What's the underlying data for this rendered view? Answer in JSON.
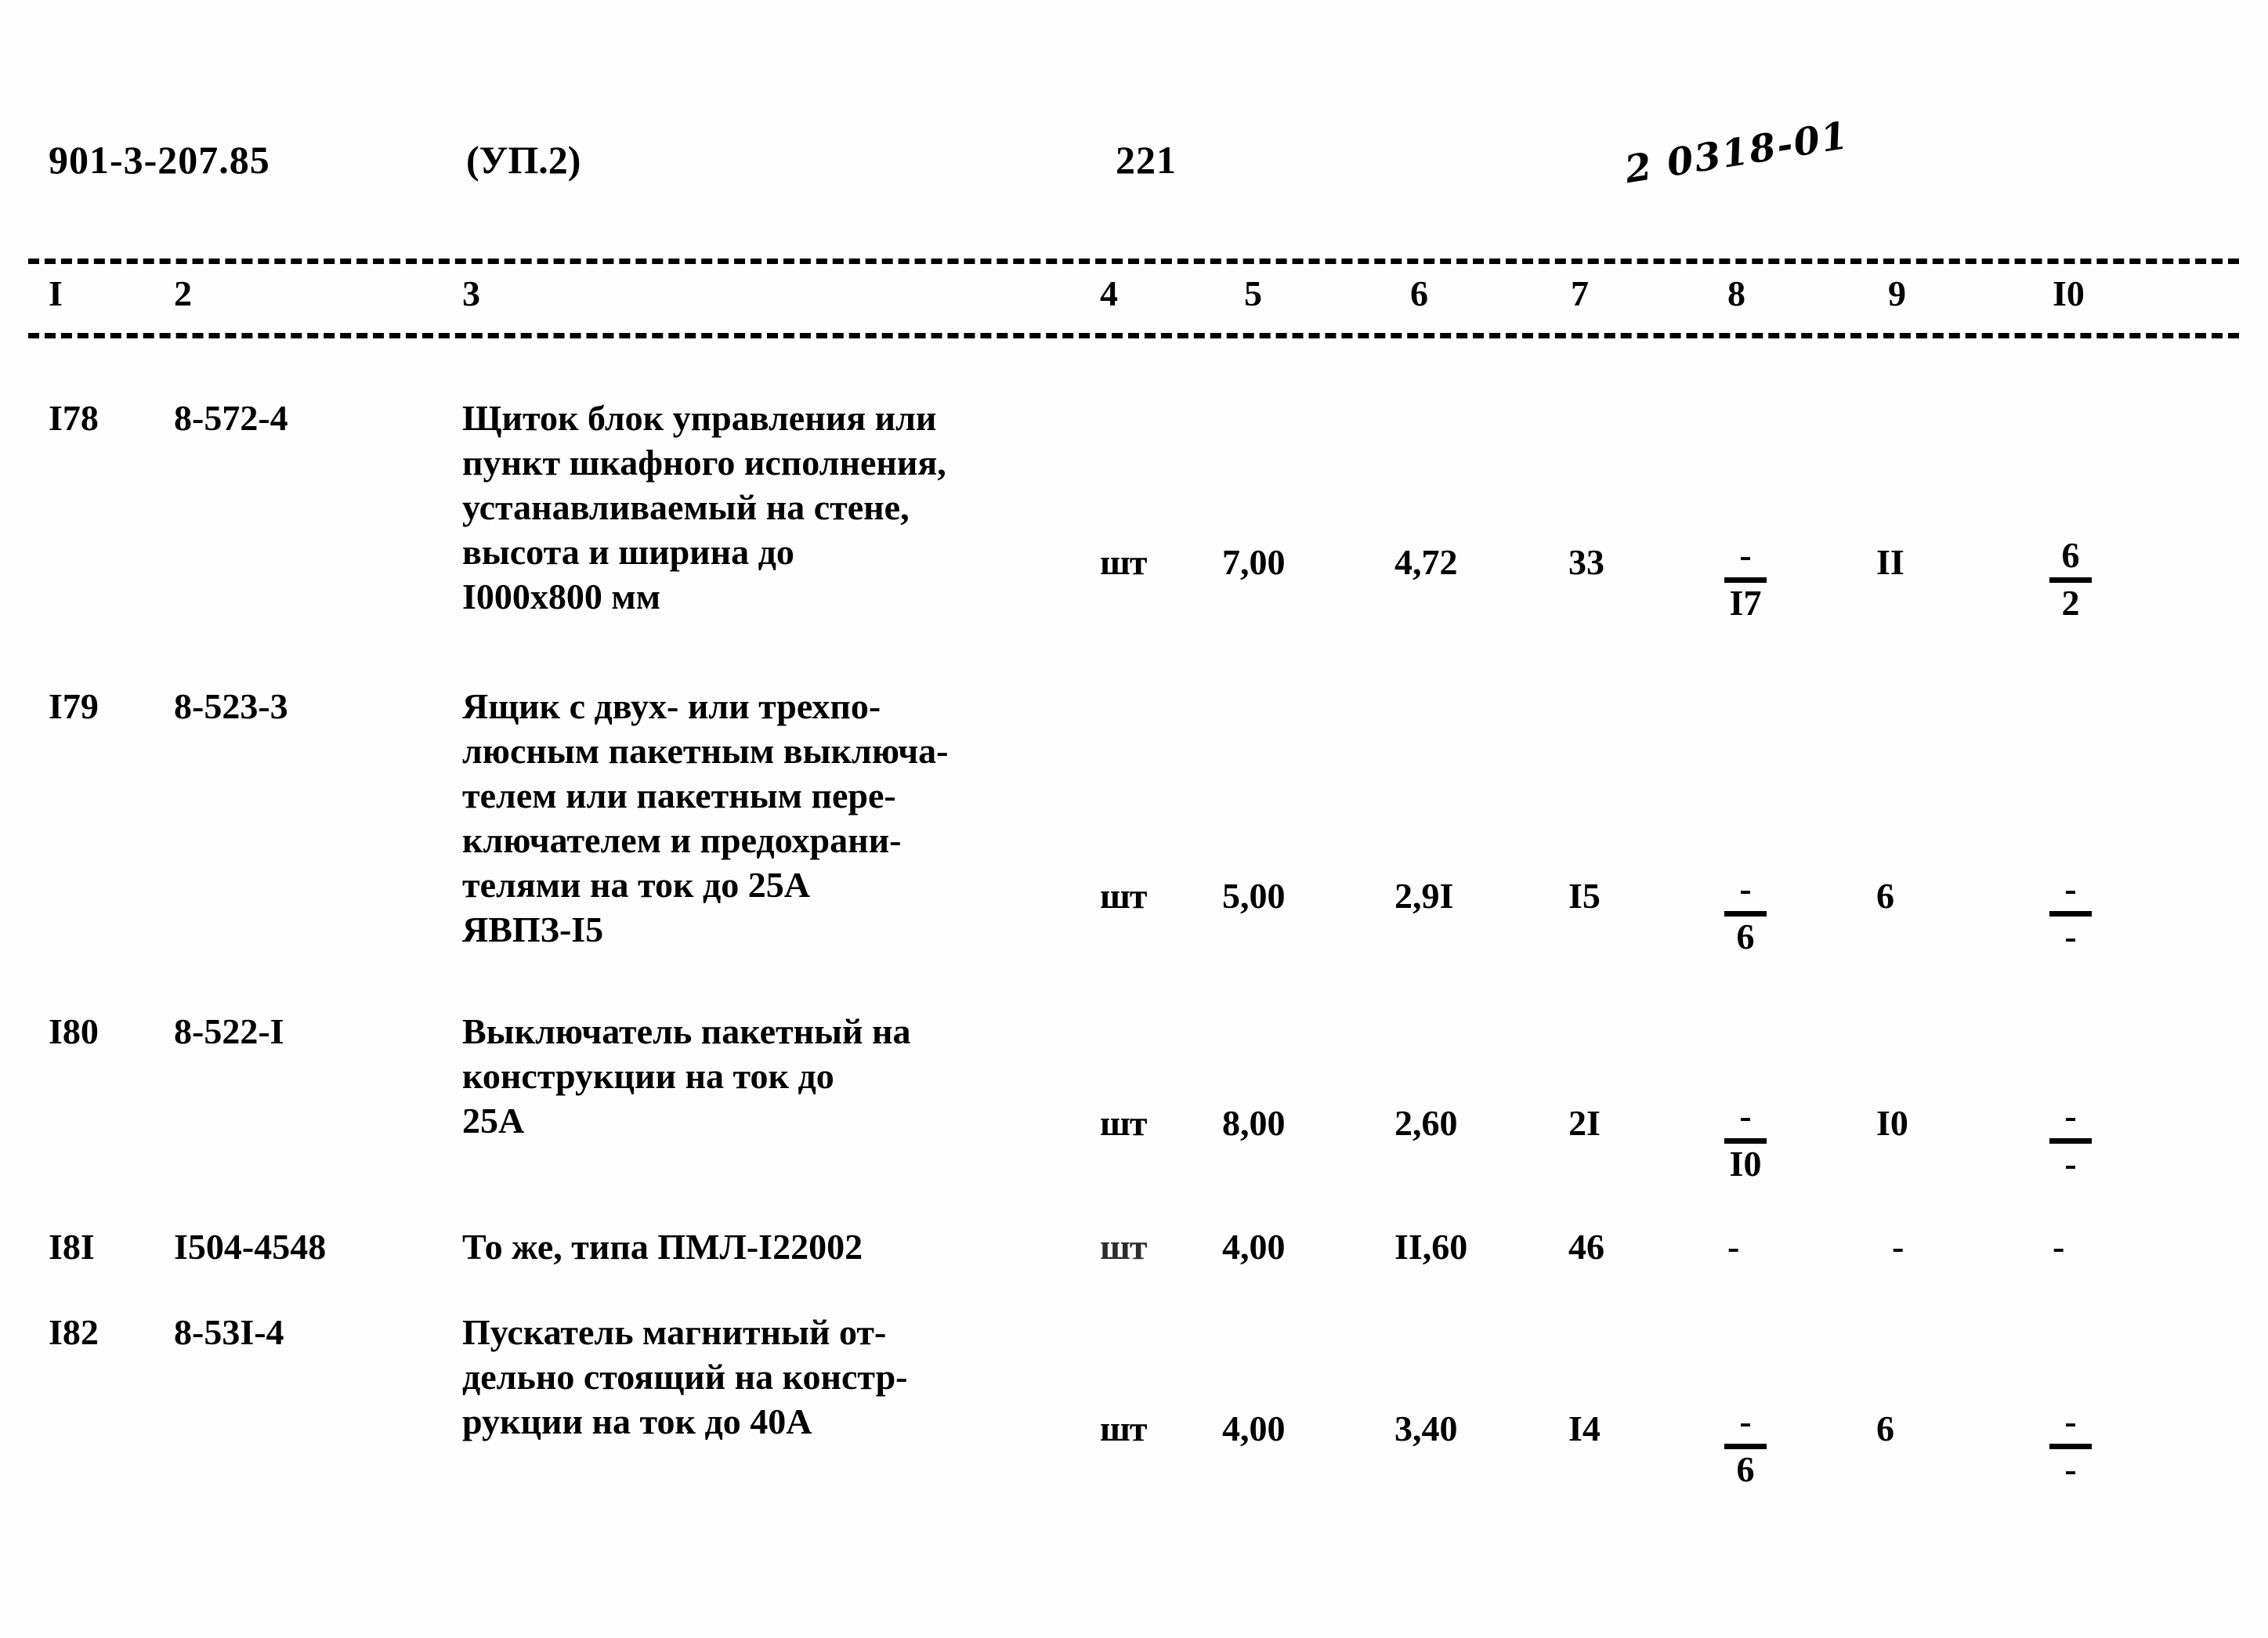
{
  "header": {
    "doc_code": "901-3-207.85",
    "part": "(УП.2)",
    "page_number": "221",
    "handwritten_stamp": "2 0318-01"
  },
  "table": {
    "column_numbers": [
      "I",
      "2",
      "3",
      "4",
      "5",
      "6",
      "7",
      "8",
      "9",
      "I0"
    ],
    "rows": [
      {
        "pos": "I78",
        "code": "8-572-4",
        "description": "Щиток блок управления или\nпункт шкафного исполнения,\nустанавливаемый на стене,\nвысота и ширина до\nI000х800 мм",
        "unit": "шт",
        "col5": "7,00",
        "col6": "4,72",
        "col7": "33",
        "col8_num": "-",
        "col8_den": "I7",
        "col9": "II",
        "col10_num": "6",
        "col10_den": "2"
      },
      {
        "pos": "I79",
        "code": "8-523-3",
        "description": "Ящик с двух- или трехпо-\nлюсным пакетным выключа-\nтелем или пакетным пере-\nключателем и предохрани-\nтелями на ток до 25А\nЯВПЗ-I5",
        "unit": "шт",
        "col5": "5,00",
        "col6": "2,9I",
        "col7": "I5",
        "col8_num": "-",
        "col8_den": "6",
        "col9": "6",
        "col10_num": "-",
        "col10_den": "-"
      },
      {
        "pos": "I80",
        "code": "8-522-I",
        "description": "Выключатель пакетный на\nконструкции на ток до\n25А",
        "unit": "шт",
        "col5": "8,00",
        "col6": "2,60",
        "col7": "2I",
        "col8_num": "-",
        "col8_den": "I0",
        "col9": "I0",
        "col10_num": "-",
        "col10_den": "-"
      },
      {
        "pos": "I8I",
        "code": "I504-4548",
        "description": "То же, типа ПМЛ-I22002",
        "unit": "шт",
        "col5": "4,00",
        "col6": "II,60",
        "col7": "46",
        "col8_num": "-",
        "col8_den": "",
        "col9": "-",
        "col10_num": "-",
        "col10_den": ""
      },
      {
        "pos": "I82",
        "code": "8-53I-4",
        "description": "Пускатель магнитный от-\nдельно стоящий на констр-\nрукции на ток до 40А",
        "unit": "шт",
        "col5": "4,00",
        "col6": "3,40",
        "col7": "I4",
        "col8_num": "-",
        "col8_den": "6",
        "col9": "6",
        "col10_num": "-",
        "col10_den": "-"
      }
    ]
  }
}
